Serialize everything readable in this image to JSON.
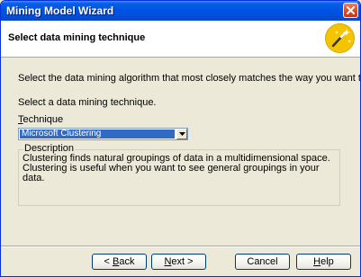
{
  "window": {
    "title": "Mining Model Wizard"
  },
  "header": {
    "title": "Select data mining technique",
    "icon": "wizard-wand-icon"
  },
  "content": {
    "intro": "Select the data mining algorithm that most closely matches the way you want to analyze your data.",
    "prompt": "Select a data mining technique.",
    "technique_label_accel": "T",
    "technique_label_rest": "echnique",
    "technique_selected": "Microsoft Clustering",
    "description_legend": "Description",
    "description_text": "Clustering finds natural groupings of data in a multidimensional space. Clustering is useful when you want to see general groupings in your data."
  },
  "buttons": {
    "back_prefix": "< ",
    "back_accel": "B",
    "back_rest": "ack",
    "next_accel": "N",
    "next_rest": "ext >",
    "cancel": "Cancel",
    "help_accel": "H",
    "help_rest": "elp"
  },
  "colors": {
    "title_bar": "#0054e3",
    "selection": "#316ac5",
    "close_button": "#d8502d"
  }
}
